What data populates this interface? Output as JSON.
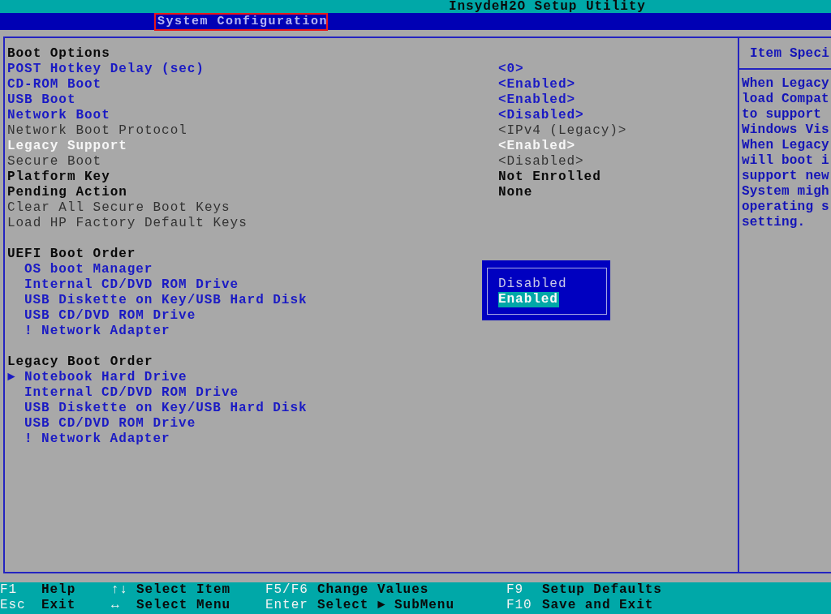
{
  "title": "InsydeH2O Setup Utility",
  "menu_tabs": [
    {
      "label": "System Configuration",
      "selected": true,
      "highlighted": true
    }
  ],
  "boot_options": {
    "heading": "Boot Options",
    "items": [
      {
        "label": "POST Hotkey Delay (sec)",
        "value": "<0>",
        "kind": "setting",
        "disabled": false,
        "selected": false
      },
      {
        "label": "CD-ROM Boot",
        "value": "<Enabled>",
        "kind": "setting",
        "disabled": false,
        "selected": false
      },
      {
        "label": "USB Boot",
        "value": "<Enabled>",
        "kind": "setting",
        "disabled": false,
        "selected": false
      },
      {
        "label": "Network Boot",
        "value": "<Disabled>",
        "kind": "setting",
        "disabled": false,
        "selected": false
      },
      {
        "label": "Network Boot Protocol",
        "value": "<IPv4 (Legacy)>",
        "kind": "setting",
        "disabled": true,
        "selected": false
      },
      {
        "label": "Legacy Support",
        "value": "<Enabled>",
        "kind": "setting",
        "disabled": false,
        "selected": true
      },
      {
        "label": "Secure Boot",
        "value": "<Disabled>",
        "kind": "setting",
        "disabled": true,
        "selected": false
      },
      {
        "label": "Platform Key",
        "value": "Not Enrolled",
        "kind": "info",
        "disabled": false,
        "selected": false
      },
      {
        "label": "Pending Action",
        "value": "None",
        "kind": "info",
        "disabled": false,
        "selected": false
      },
      {
        "label": "Clear All Secure Boot Keys",
        "kind": "setting",
        "disabled": true,
        "selected": false
      },
      {
        "label": "Load HP Factory Default Keys",
        "kind": "setting",
        "disabled": true,
        "selected": false
      }
    ]
  },
  "uefi_boot_order": {
    "heading": "UEFI Boot Order",
    "items": [
      {
        "label": "OS boot Manager"
      },
      {
        "label": "Internal CD/DVD ROM Drive"
      },
      {
        "label": "USB Diskette on Key/USB Hard Disk"
      },
      {
        "label": "USB CD/DVD ROM Drive"
      },
      {
        "label": "! Network Adapter"
      }
    ]
  },
  "legacy_boot_order": {
    "heading": "Legacy Boot Order",
    "items": [
      {
        "label": "Notebook Hard Drive",
        "marker": "►"
      },
      {
        "label": "Internal CD/DVD ROM Drive"
      },
      {
        "label": "USB Diskette on Key/USB Hard Disk"
      },
      {
        "label": "USB CD/DVD ROM Drive"
      },
      {
        "label": "! Network Adapter"
      }
    ]
  },
  "value_popup": {
    "options": [
      {
        "label": "Disabled",
        "selected": false
      },
      {
        "label": "Enabled",
        "selected": true
      }
    ]
  },
  "help_panel": {
    "title": "Item Speci",
    "lines": [
      "When Legacy",
      "load Compat",
      "to support",
      "Windows Vis",
      "When Legacy",
      "will boot i",
      "support new",
      "System migh",
      "operating s",
      "setting."
    ]
  },
  "key_legend": [
    {
      "items": [
        {
          "key": "F1",
          "action": "Help"
        },
        {
          "key": "↑↓",
          "action": "Select Item"
        },
        {
          "key": "F5/F6",
          "action": "Change Values"
        },
        {
          "key": "F9",
          "action": "Setup Defaults"
        }
      ]
    },
    {
      "items": [
        {
          "key": "Esc",
          "action": "Exit"
        },
        {
          "key": "↔",
          "action": "Select Menu"
        },
        {
          "key": "Enter",
          "action": "Select ► SubMenu"
        },
        {
          "key": "F10",
          "action": "Save and Exit"
        }
      ]
    }
  ]
}
